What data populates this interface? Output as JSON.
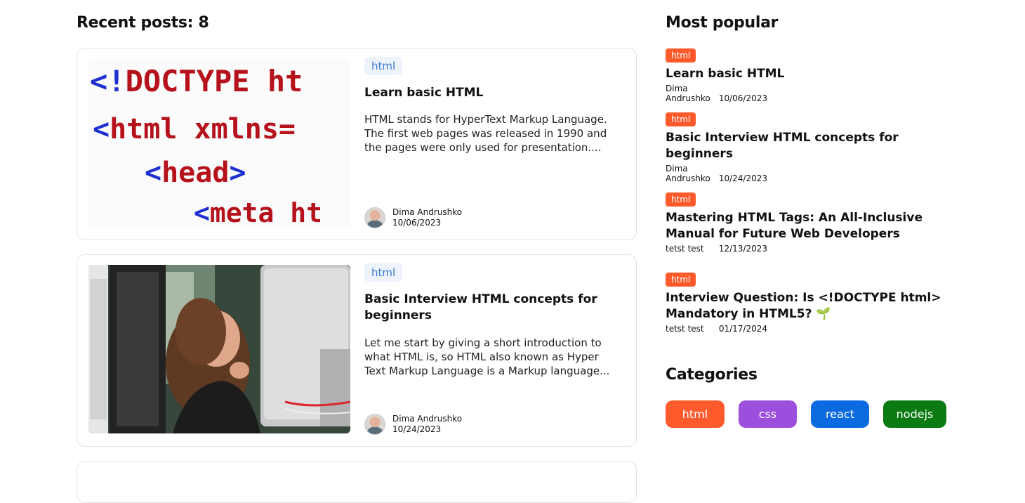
{
  "recent": {
    "heading": "Recent posts: 8",
    "posts": [
      {
        "tag": "html",
        "title": "Learn basic HTML",
        "description": "HTML stands for HyperText Markup Language. The first web pages was released in 1990 and the pages were only used for presentation....",
        "author": "Dima Andrushko",
        "date": "10/06/2023",
        "image": {
          "line1_open": "<!",
          "line1_word": "DOCTYPE ht",
          "line2_open": "<",
          "line2_word": "html ",
          "line2_attr": "xmlns=",
          "line3_open": "<",
          "line3_word": "head",
          "line3_close": ">",
          "line4_open": "<",
          "line4_word": "meta ht"
        }
      },
      {
        "tag": "html",
        "title": "Basic Interview HTML concepts for beginners",
        "description": "Let me start by giving a short introduction to what HTML is, so HTML also known as Hyper Text Markup Language is a Markup language...",
        "author": "Dima Andrushko",
        "date": "10/24/2023"
      }
    ]
  },
  "popular": {
    "heading": "Most popular",
    "items": [
      {
        "tag": "html",
        "title": "Learn basic HTML",
        "author": "Dima Andrushko",
        "date": "10/06/2023"
      },
      {
        "tag": "html",
        "title": "Basic Interview HTML concepts for beginners",
        "author": "Dima Andrushko",
        "date": "10/24/2023"
      },
      {
        "tag": "html",
        "title": "Mastering HTML Tags: An All-Inclusive Manual for Future Web Developers",
        "author": "tetst test",
        "date": "12/13/2023"
      },
      {
        "tag": "html",
        "title": "Interview Question: Is <!DOCTYPE html> Mandatory in HTML5? 🌱",
        "author": "tetst test",
        "date": "01/17/2024"
      }
    ]
  },
  "categories": {
    "heading": "Categories",
    "items": [
      {
        "label": "html",
        "color": "#ff5a2c"
      },
      {
        "label": "css",
        "color": "#9b4fdc"
      },
      {
        "label": "react",
        "color": "#0a6ae0"
      },
      {
        "label": "nodejs",
        "color": "#0a7a12"
      }
    ]
  }
}
